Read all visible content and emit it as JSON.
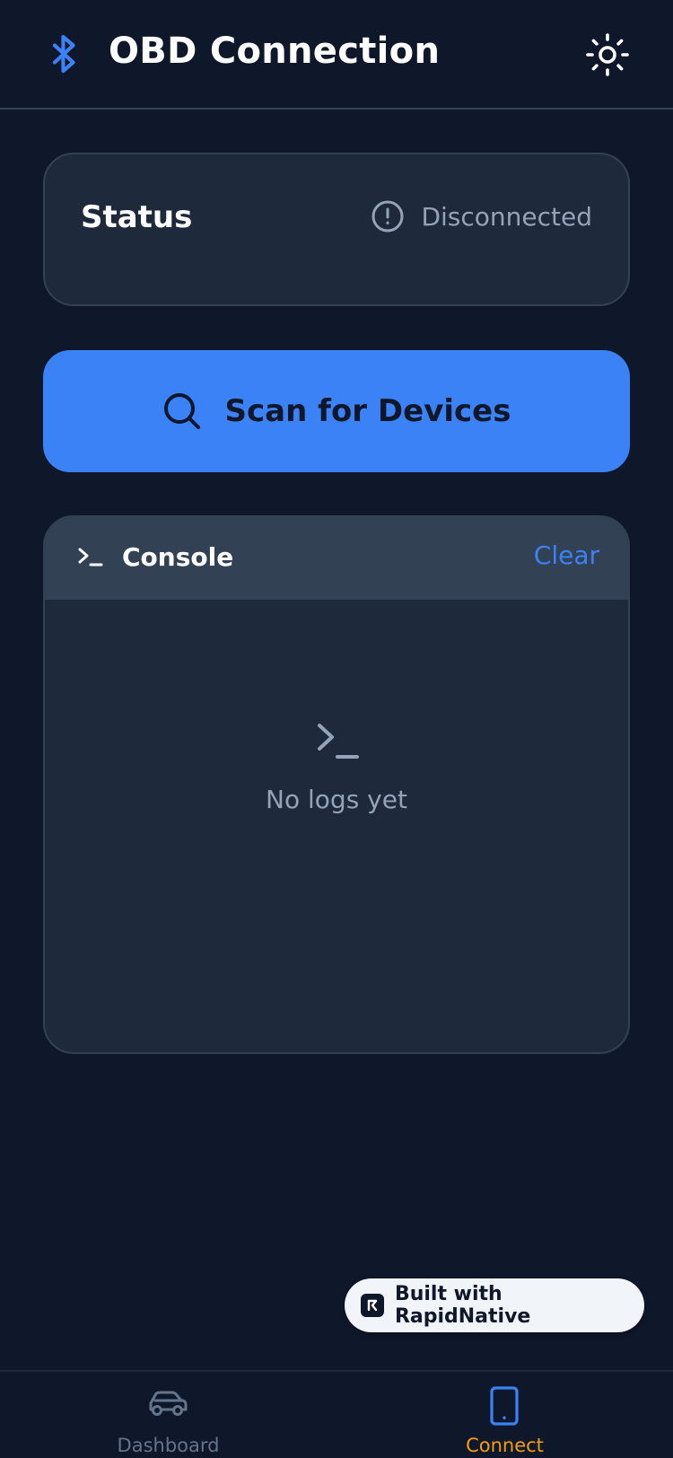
{
  "header": {
    "title": "OBD Connection",
    "bluetooth_icon": "bluetooth-icon",
    "theme_icon": "sun-icon"
  },
  "status": {
    "title": "Status",
    "state": "Disconnected",
    "icon": "alert-circle-icon"
  },
  "scan": {
    "label": "Scan for Devices",
    "icon": "search-icon"
  },
  "console": {
    "title": "Console",
    "clear_label": "Clear",
    "empty_text": "No logs yet",
    "icon": "terminal-icon"
  },
  "badge": {
    "label": "Built with RapidNative"
  },
  "nav": {
    "items": [
      {
        "label": "Dashboard",
        "icon": "car-icon",
        "active": false
      },
      {
        "label": "Connect",
        "icon": "smartphone-icon",
        "active": true
      }
    ]
  },
  "colors": {
    "background": "#0f172a",
    "card": "#1e293b",
    "border": "#334155",
    "accent": "#3b82f6",
    "muted": "#94a3b8",
    "active_tab": "#f59e0b"
  }
}
